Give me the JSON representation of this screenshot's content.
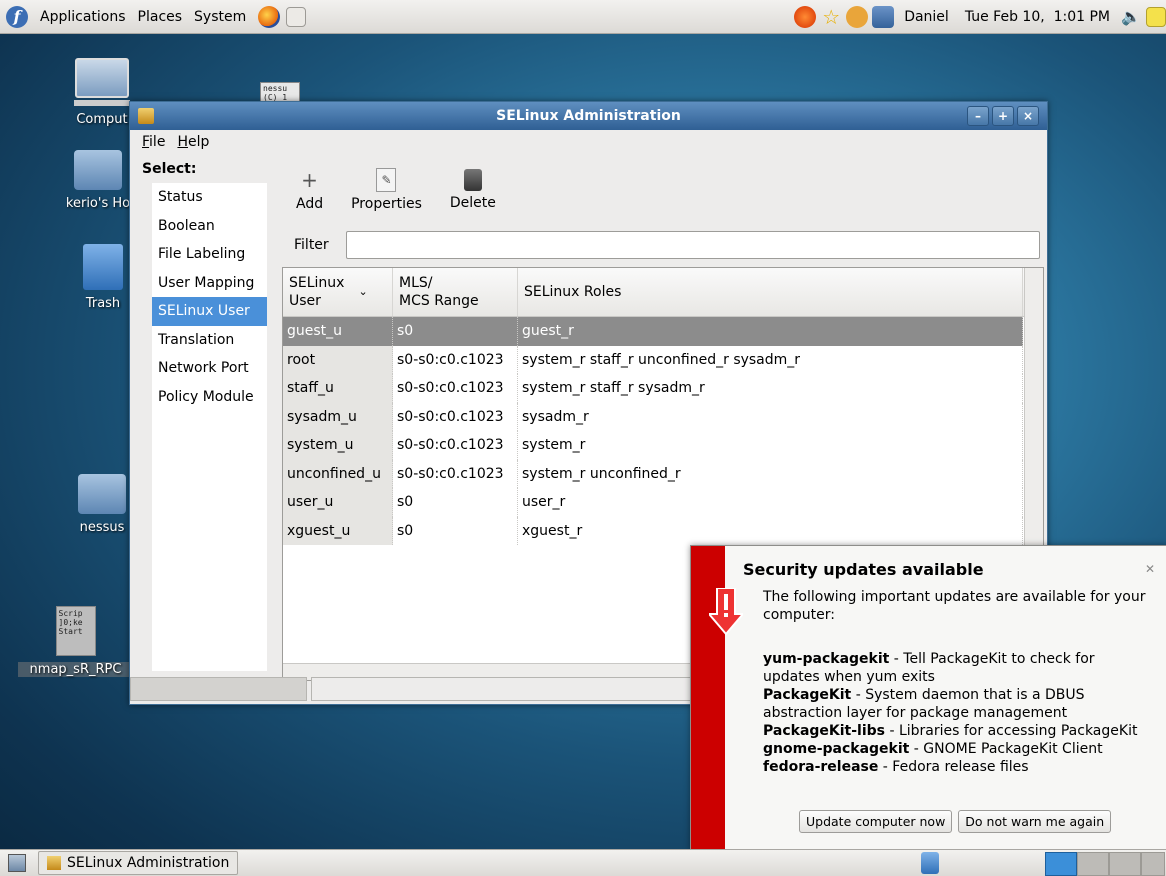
{
  "top_panel": {
    "menus": [
      "Applications",
      "Places",
      "System"
    ],
    "user": "Daniel",
    "datetime": "Tue Feb 10,  1:01 PM"
  },
  "desktop": {
    "icons": [
      {
        "label": "Comput",
        "icon": "computer-icon"
      },
      {
        "label": "kerio's Ho",
        "icon": "home-folder-icon"
      },
      {
        "label": "Trash",
        "icon": "trash-icon"
      },
      {
        "label": "nessus",
        "icon": "folder-icon"
      },
      {
        "label": "nmap_sR_RPC",
        "icon": "text-file-icon",
        "preview": "Scrip\n]0;ke\nStart"
      },
      {
        "label": "",
        "icon": "text-file-icon",
        "preview": "nessu\n(C) 1"
      }
    ]
  },
  "window": {
    "title": "SELinux Administration",
    "menu": [
      {
        "label": "File",
        "mnemonic": "F"
      },
      {
        "label": "Help",
        "mnemonic": "H"
      }
    ],
    "select_label": "Select:",
    "nav": [
      "Status",
      "Boolean",
      "File Labeling",
      "User Mapping",
      "SELinux User",
      "Translation",
      "Network Port",
      "Policy Module"
    ],
    "nav_selected": "SELinux User",
    "toolbar": {
      "add": "Add",
      "properties": "Properties",
      "delete": "Delete"
    },
    "filter_label": "Filter",
    "filter_value": "",
    "table": {
      "headers": [
        "SELinux\nUser",
        "MLS/\nMCS Range",
        "SELinux Roles"
      ],
      "rows": [
        [
          "guest_u",
          "s0",
          "guest_r"
        ],
        [
          "root",
          "s0-s0:c0.c1023",
          "system_r staff_r unconfined_r sysadm_r"
        ],
        [
          "staff_u",
          "s0-s0:c0.c1023",
          "system_r staff_r sysadm_r"
        ],
        [
          "sysadm_u",
          "s0-s0:c0.c1023",
          "sysadm_r"
        ],
        [
          "system_u",
          "s0-s0:c0.c1023",
          "system_r"
        ],
        [
          "unconfined_u",
          "s0-s0:c0.c1023",
          "system_r unconfined_r"
        ],
        [
          "user_u",
          "s0",
          "user_r"
        ],
        [
          "xguest_u",
          "s0",
          "xguest_r"
        ]
      ],
      "selected_row": "guest_u"
    }
  },
  "notification": {
    "title": "Security updates available",
    "intro": "The following important updates are available for your computer:",
    "updates": [
      {
        "name": "yum-packagekit",
        "desc": " - Tell PackageKit to check for updates when yum exits"
      },
      {
        "name": "PackageKit",
        "desc": " - System daemon that is a DBUS abstraction layer for package management"
      },
      {
        "name": "PackageKit-libs",
        "desc": " - Libraries for accessing PackageKit"
      },
      {
        "name": "gnome-packagekit",
        "desc": " - GNOME PackageKit Client"
      },
      {
        "name": "fedora-release",
        "desc": " - Fedora release files"
      }
    ],
    "buttons": [
      "Update computer now",
      "Do not warn me again"
    ]
  },
  "taskbar": {
    "task": "SELinux Administration"
  },
  "colors": {
    "selection": "#4a90d9",
    "titlebar": "#3a6ea5",
    "notify_bar": "#cc0000",
    "row_selected": "#8c8c8c"
  }
}
